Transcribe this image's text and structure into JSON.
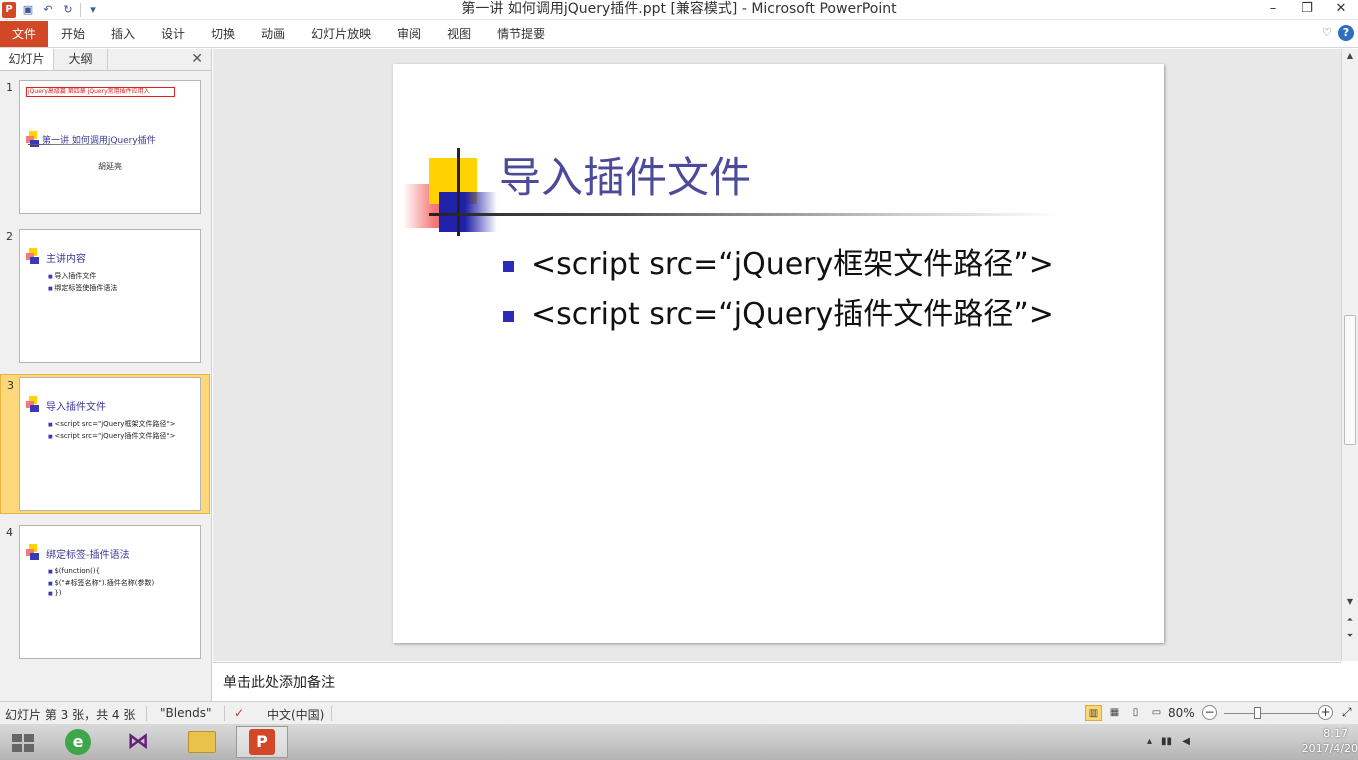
{
  "window": {
    "title": "第一讲 如何调用jQuery插件.ppt [兼容模式] - Microsoft PowerPoint",
    "logo": "P"
  },
  "ribbon": {
    "tabs": [
      "文件",
      "开始",
      "插入",
      "设计",
      "切换",
      "动画",
      "幻灯片放映",
      "审阅",
      "视图",
      "情节提要"
    ],
    "help": "?"
  },
  "pane": {
    "tabs": [
      "幻灯片",
      "大纲"
    ],
    "close": "✕"
  },
  "slides": [
    {
      "num": "1",
      "banner": "jQuery高级篇 第四章 jQuery常用插件应用入",
      "title": "第一讲 如何调用jQuery插件",
      "author": "胡延亮"
    },
    {
      "num": "2",
      "title": "主讲内容",
      "bullets": [
        "导入插件文件",
        "绑定标签使插件语法"
      ]
    },
    {
      "num": "3",
      "title": "导入插件文件",
      "bullets": [
        "<script src=\"jQuery框架文件路径\">",
        "<script src=\"jQuery插件文件路径\">"
      ]
    },
    {
      "num": "4",
      "title": "绑定标签-插件语法",
      "bullets": [
        "$(function(){",
        "    $(\"#标签名称\").插件名称(参数)",
        "})"
      ]
    }
  ],
  "current_slide": {
    "title": "导入插件文件",
    "bullets": [
      "<script src=“jQuery框架文件路径”>",
      "<script src=“jQuery插件文件路径”>"
    ]
  },
  "notes": {
    "placeholder": "单击此处添加备注"
  },
  "status": {
    "slide_info": "幻灯片 第 3 张，共 4 张",
    "theme": "\"Blends\"",
    "language": "中文(中国)",
    "zoom": "80%",
    "zoom_level_percent": 80
  },
  "taskbar": {
    "time": "8:17",
    "date": "2017/4/20"
  },
  "colors": {
    "accent": "#d24726",
    "title_text": "#4b4b9a",
    "bullet": "#2b2bb5",
    "selected_thumb": "#fcd87a"
  }
}
